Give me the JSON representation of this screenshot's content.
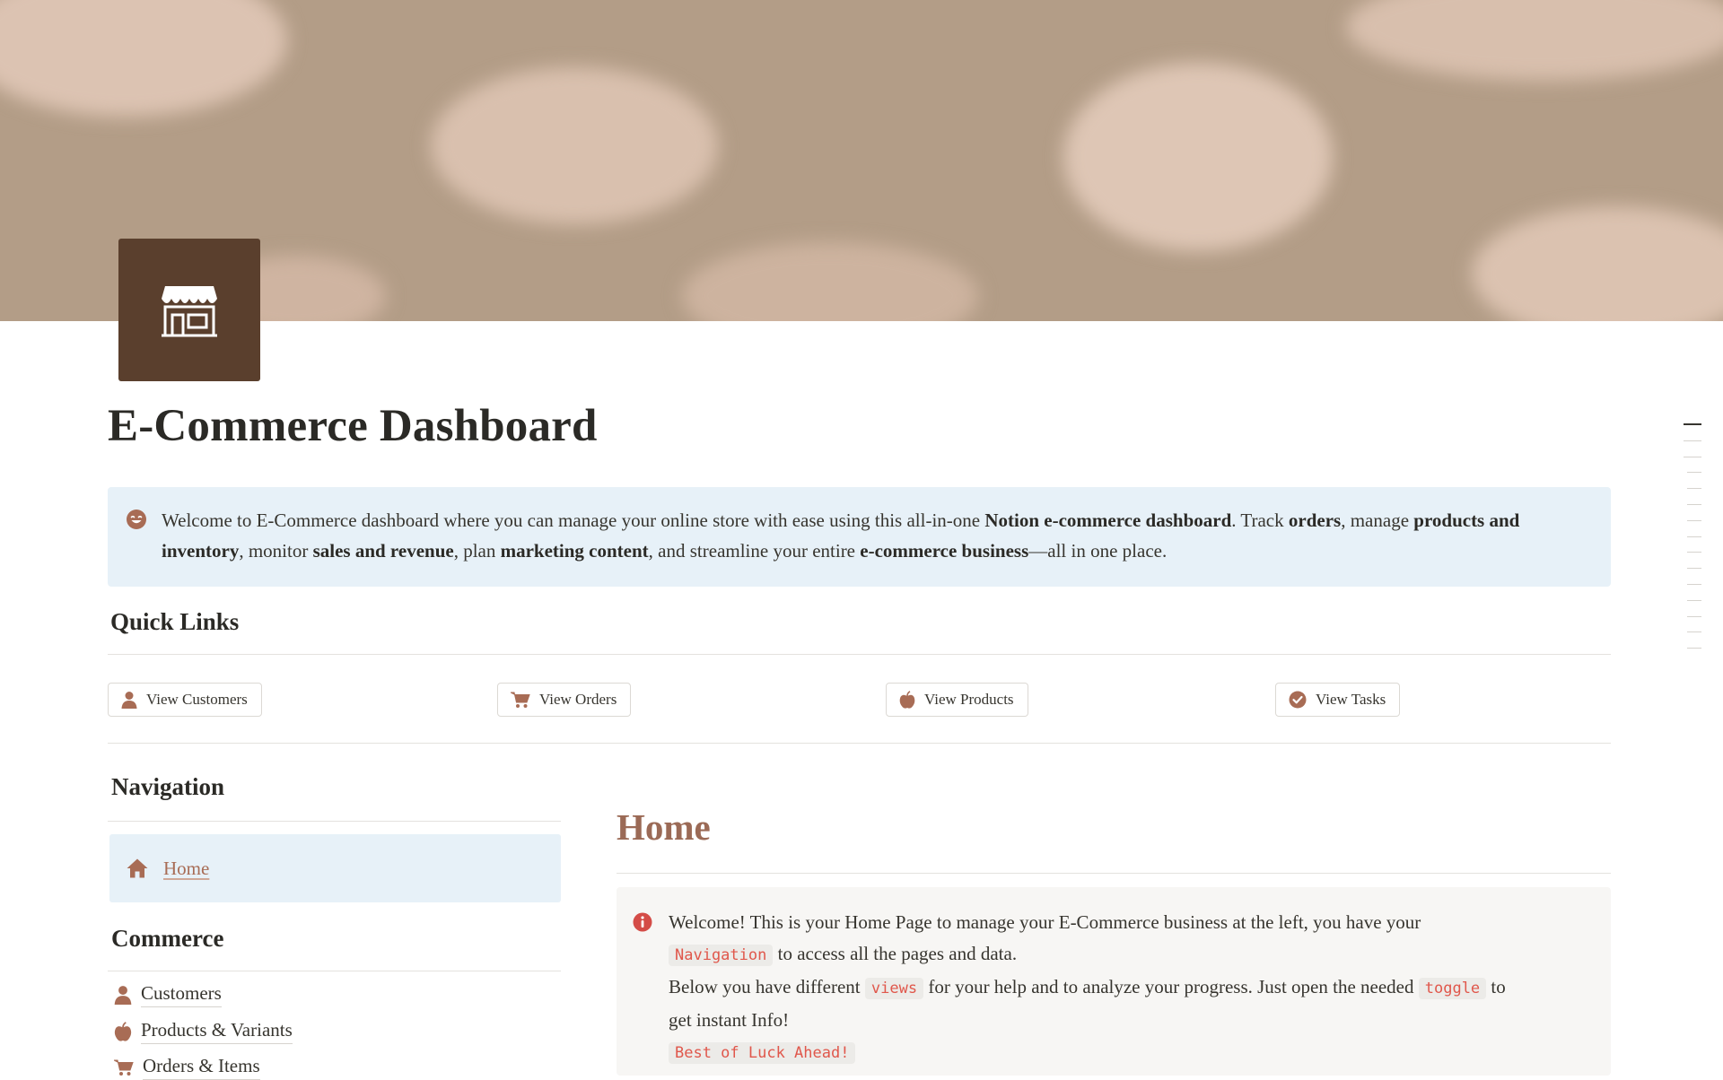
{
  "page": {
    "title": "E-Commerce Dashboard",
    "icon": "storefront-icon"
  },
  "intro_callout": {
    "icon": "smile-icon",
    "parts": [
      {
        "t": "Welcome to E-Commerce dashboard where you can manage your online store with ease using this all-in-one ",
        "b": false
      },
      {
        "t": "Notion e-commerce dashboard",
        "b": true
      },
      {
        "t": ". Track ",
        "b": false
      },
      {
        "t": "orders",
        "b": true
      },
      {
        "t": ", manage ",
        "b": false
      },
      {
        "t": "products and inventory",
        "b": true
      },
      {
        "t": ", monitor ",
        "b": false
      },
      {
        "t": "sales and revenue",
        "b": true
      },
      {
        "t": ", plan ",
        "b": false
      },
      {
        "t": "marketing content",
        "b": true
      },
      {
        "t": ", and streamline your entire ",
        "b": false
      },
      {
        "t": "e-commerce business",
        "b": true
      },
      {
        "t": "—all in one place.",
        "b": false
      }
    ]
  },
  "quick_links": {
    "heading": "Quick Links",
    "buttons": [
      {
        "label": "View Customers",
        "icon": "person-icon"
      },
      {
        "label": "View Orders",
        "icon": "cart-icon"
      },
      {
        "label": "View Products",
        "icon": "apple-icon"
      },
      {
        "label": "View Tasks",
        "icon": "check-circle-icon"
      }
    ]
  },
  "navigation": {
    "heading": "Navigation",
    "home_label": "Home",
    "home_icon": "house-icon"
  },
  "commerce": {
    "heading": "Commerce",
    "items": [
      {
        "label": "Customers",
        "icon": "person-icon"
      },
      {
        "label": "Products & Variants",
        "icon": "apple-icon"
      },
      {
        "label": "Orders & Items",
        "icon": "cart-icon"
      }
    ]
  },
  "home": {
    "heading": "Home",
    "callout": {
      "icon": "info-icon",
      "line1": "Welcome! This is your Home Page to manage your E-Commerce business at the left, you have your",
      "code_navigation": "Navigation",
      "line2": "to access all the pages and data.",
      "line3a": "Below you have different",
      "code_views": "views",
      "line3b": "for your help and to analyze your progress. Just open the needed",
      "code_toggle": "toggle",
      "line3c": "to",
      "line4": "get instant Info!",
      "code_luck": "Best of Luck Ahead!"
    }
  },
  "colors": {
    "cover": "#b39d87",
    "icon_bg": "#5a3f2d",
    "accent_brown": "#9b6a56",
    "callout_blue": "#e7f1f8",
    "code_red": "#e0574b"
  }
}
